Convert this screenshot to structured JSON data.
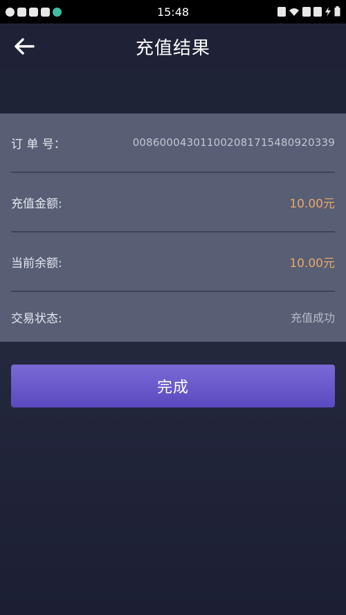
{
  "status_bar": {
    "time": "15:48"
  },
  "header": {
    "title": "充值结果"
  },
  "details": {
    "order_no_label": "订 单 号：",
    "order_no_value": "0086000430110020817154809203­39",
    "amount_label": "充值金额:",
    "amount_value": "10.00元",
    "balance_label": "当前余额:",
    "balance_value": "10.00元",
    "status_label": "交易状态:",
    "status_value": "充值成功"
  },
  "actions": {
    "done_label": "完成"
  },
  "colors": {
    "accent_button": "#6a58cc",
    "amount_text": "#e8a869"
  }
}
